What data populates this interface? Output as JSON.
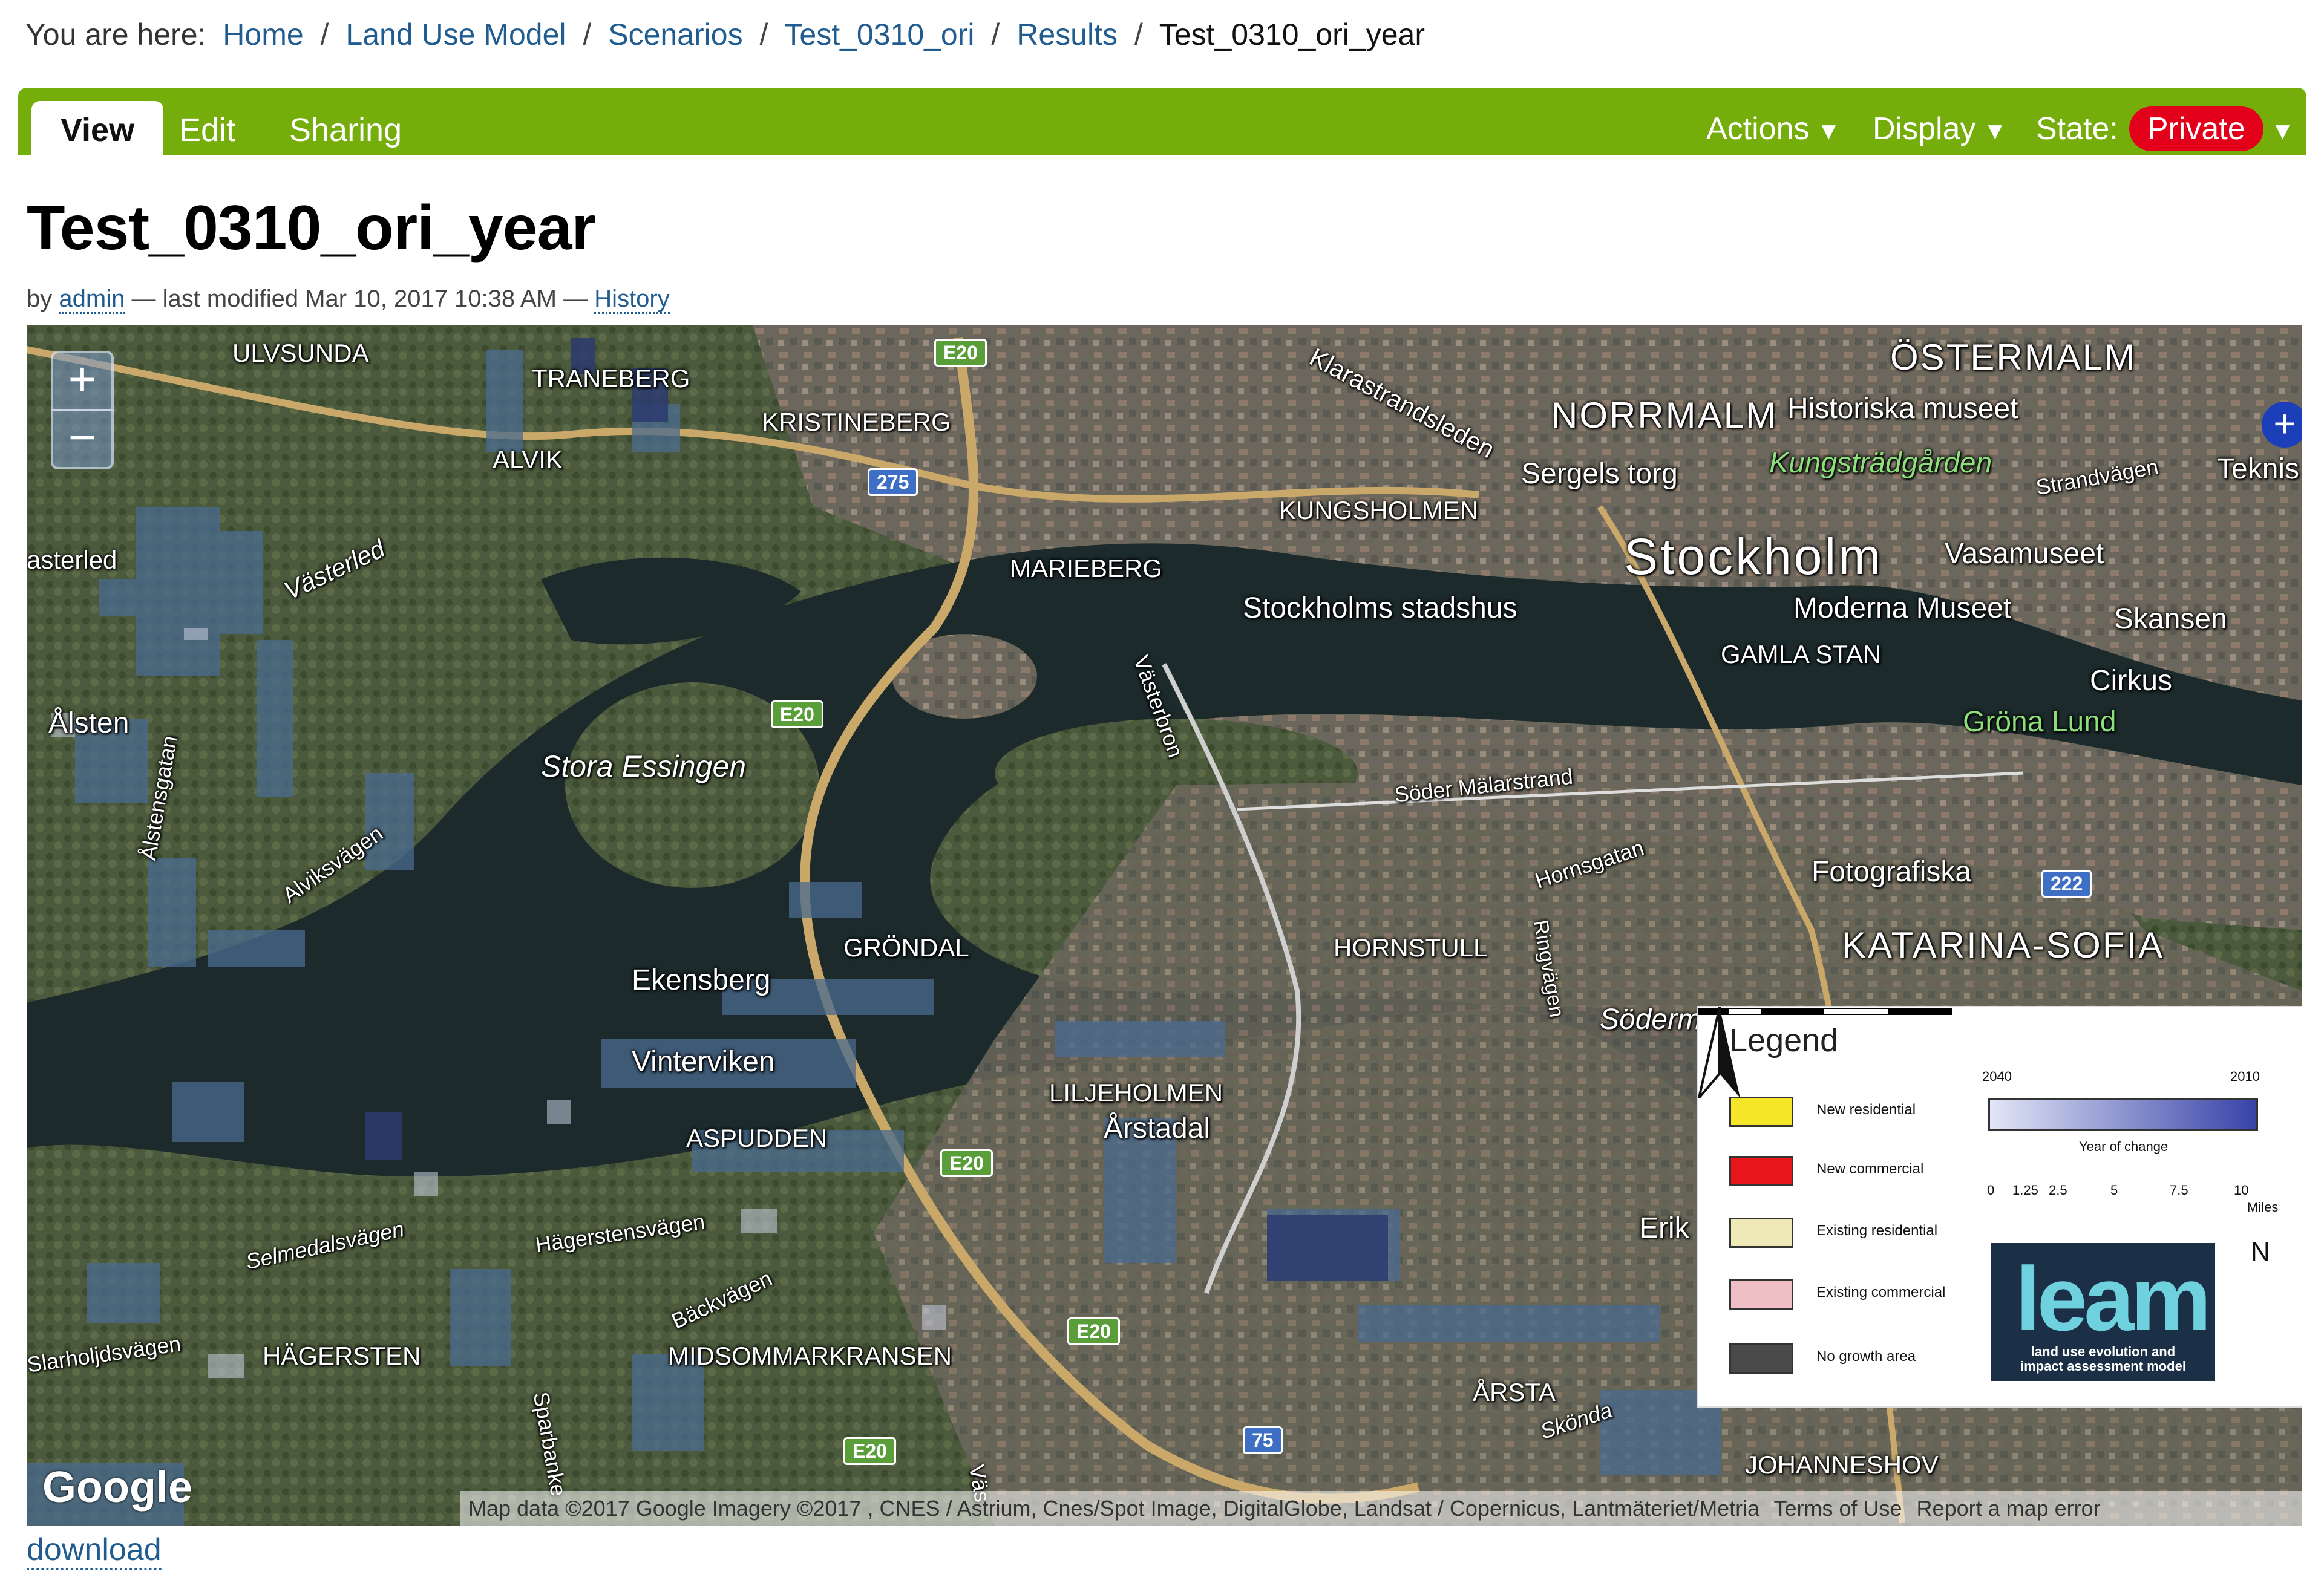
{
  "breadcrumb": {
    "prefix": "You are here:",
    "items": [
      "Home",
      "Land Use Model",
      "Scenarios",
      "Test_0310_ori",
      "Results"
    ],
    "current": "Test_0310_ori_year",
    "separator": "/"
  },
  "toolbar": {
    "tabs": [
      "View",
      "Edit",
      "Sharing"
    ],
    "actions_label": "Actions",
    "display_label": "Display",
    "state_label": "State:",
    "state_value": "Private",
    "dropdown_glyph": "▼",
    "accent_color": "#75ad0a",
    "state_color": "#e3001b"
  },
  "page": {
    "title": "Test_0310_ori_year",
    "by": "by",
    "author": "admin",
    "modified": "— last modified Mar 10, 2017 10:38 AM —",
    "history": "History"
  },
  "map": {
    "zoom_in": "+",
    "zoom_out": "−",
    "expand_icon": "+",
    "google": "Google",
    "labels": {
      "ulvsunda": "ULVSUNDA",
      "traneberg": "TRANEBERG",
      "alvik": "ALVIK",
      "kristineberg": "KRISTINEBERG",
      "klarastrandsleden": "Klarastrandsleden",
      "ostermalm": "ÖSTERMALM",
      "normalm": "NORRMALM",
      "historiska": "Historiska museet",
      "kungstradgarden": "Kungsträdgården",
      "sergels": "Sergels torg",
      "strandvagen": "Strandvägen",
      "teknis": "Teknis",
      "kungsholmen": "KUNGSHOLMEN",
      "stockholm": "Stockholm",
      "vasamuseet": "Vasamuseet",
      "asterled": "asterled",
      "vasterled": "Västerled",
      "marieberg": "MARIEBERG",
      "stadshus": "Stockholms stadshus",
      "moderna": "Moderna Museet",
      "skansen": "Skansen",
      "gamlastan": "GAMLA STAN",
      "cirkus": "Cirkus",
      "gronalund": "Gröna Lund",
      "alsten": "Ålsten",
      "vasterbron": "Västerbron",
      "stora": "Stora Essingen",
      "soder": "Söder Mälarstrand",
      "alstensgatan": "Ålstensgatan",
      "alviksvagen": "Alviksvägen",
      "hornsgatan": "Hornsgatan",
      "fotografiska": "Fotografiska",
      "katarina": "KATARINA-SOFIA",
      "grondal": "GRÖNDAL",
      "hornstull": "HORNSTULL",
      "ringvagen": "Ringvägen",
      "ekensberg": "Ekensberg",
      "sodermalm": "Söderm",
      "vinterviken": "Vinterviken",
      "liljeholmen": "LILJEHOLMEN",
      "arstadal": "Årstadal",
      "aspudden": "ASPUDDEN",
      "selmedalsvagen": "Selmedalsvägen",
      "hagerstensvagen": "Hägerstensvägen",
      "erik": "Erik",
      "backvagen": "Bäckvägen",
      "larholjdsvagen": "Slarholjdsvägen",
      "hagersten": "HÄGERSTEN",
      "midsommarkransen": "MIDSOMMARKRANSEN",
      "arsta": "ÅRSTA",
      "skonda": "Skönda",
      "sparbanke": "Sparbanke",
      "johanneshov": "JOHANNESHOV",
      "vas": "Väs"
    },
    "shields": {
      "e20_top": "E20",
      "r275": "275",
      "e20_mid": "E20",
      "e20_low": "E20",
      "e20_bottom": "E20",
      "e20_lowest": "E20",
      "r222": "222",
      "r75": "75"
    },
    "attribution": {
      "data": "Map data ©2017 Google Imagery ©2017 , CNES / Astrium, Cnes/Spot Image, DigitalGlobe, Landsat / Copernicus, Lantmäteriet/Metria",
      "terms": "Terms of Use",
      "report": "Report a map error"
    }
  },
  "legend": {
    "title": "Legend",
    "items": [
      {
        "label": "New residential",
        "color": "#f5e629"
      },
      {
        "label": "New commercial",
        "color": "#e8151b"
      },
      {
        "label": "Existing residential",
        "color": "#efe9b8"
      },
      {
        "label": "Existing commercial",
        "color": "#eebfc5"
      },
      {
        "label": "No growth area",
        "color": "#4a4a4a"
      }
    ],
    "gradient_start": "2040",
    "gradient_end": "2010",
    "gradient_caption": "Year of change",
    "scale_ticks": [
      "0",
      "1.25",
      "2.5",
      "5",
      "7.5",
      "10"
    ],
    "scale_unit": "Miles",
    "logo_word": "leam",
    "logo_subtitle_1": "land use evolution and",
    "logo_subtitle_2": "impact assessment model",
    "north": "N"
  },
  "footer": {
    "download": "download"
  }
}
